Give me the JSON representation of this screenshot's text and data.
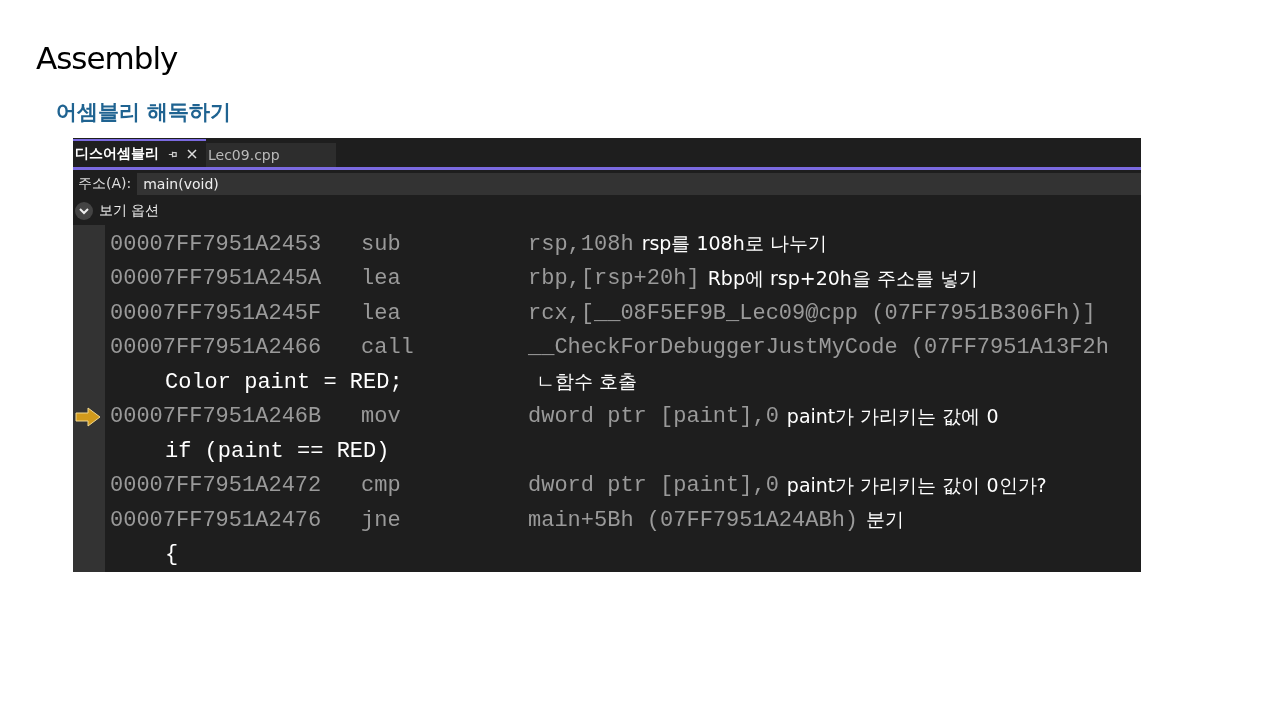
{
  "slide": {
    "title": "Assembly",
    "subtitle": "어셈블리 해독하기"
  },
  "tabs": [
    {
      "label": "디스어셈블리",
      "selected": true
    },
    {
      "label": "Lec09.cpp",
      "selected": false
    }
  ],
  "address_bar": {
    "label": "주소(A):",
    "value": "main(void)"
  },
  "view_options": {
    "label": "보기 옵션",
    "expanded": true
  },
  "rows": [
    {
      "kind": "asm",
      "address": "00007FF7951A2453",
      "mnemonic": "sub",
      "operand": "rsp,108h",
      "note": "rsp를 108h로 나누기",
      "current": false
    },
    {
      "kind": "asm",
      "address": "00007FF7951A245A",
      "mnemonic": "lea",
      "operand": "rbp,[rsp+20h]",
      "note": "Rbp에 rsp+20h을 주소를 넣기",
      "current": false
    },
    {
      "kind": "asm",
      "address": "00007FF7951A245F",
      "mnemonic": "lea",
      "operand": "rcx,[__08F5EF9B_Lec09@cpp (07FF7951B306Fh)]",
      "current": false
    },
    {
      "kind": "asm",
      "address": "00007FF7951A2466",
      "mnemonic": "call",
      "operand": "__CheckForDebuggerJustMyCode (07FF7951A13F2h",
      "current": false
    },
    {
      "kind": "source",
      "code": "Color paint = RED;",
      "note": "ㄴ함수 호출"
    },
    {
      "kind": "asm",
      "address": "00007FF7951A246B",
      "mnemonic": "mov",
      "operand": "dword ptr [paint],0",
      "note": "paint가 가리키는 값에 0",
      "current": true
    },
    {
      "kind": "source",
      "code": "if (paint == RED)"
    },
    {
      "kind": "asm",
      "address": "00007FF7951A2472",
      "mnemonic": "cmp",
      "operand": "dword ptr [paint],0",
      "note": "paint가 가리키는 값이 0인가?",
      "current": false
    },
    {
      "kind": "asm",
      "address": "00007FF7951A2476",
      "mnemonic": "jne",
      "operand": "main+5Bh (07FF7951A24ABh)",
      "note": "분기",
      "current": false
    },
    {
      "kind": "source",
      "code": "{"
    }
  ]
}
